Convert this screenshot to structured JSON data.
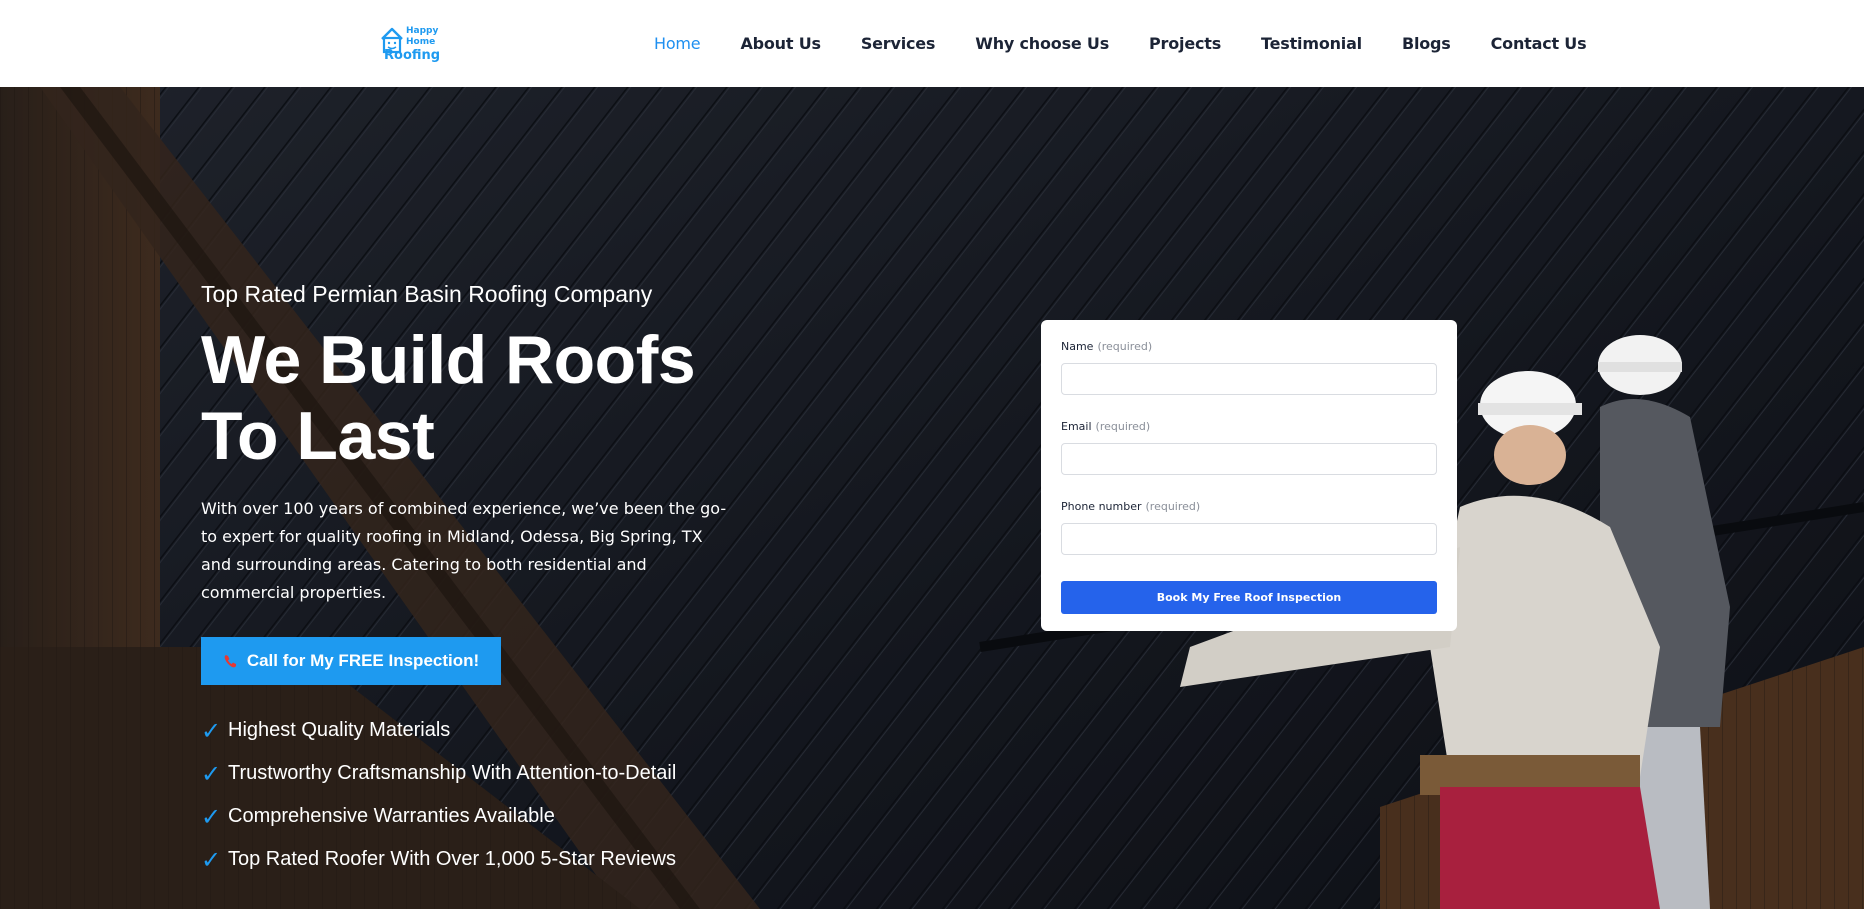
{
  "brand": {
    "logo_line1": "Happy",
    "logo_line2": "Home",
    "logo_line3": "Roofing",
    "accent_color": "#1e9af0"
  },
  "nav": {
    "items": [
      {
        "label": "Home",
        "active": true
      },
      {
        "label": "About Us"
      },
      {
        "label": "Services"
      },
      {
        "label": "Why choose Us"
      },
      {
        "label": "Projects"
      },
      {
        "label": "Testimonial"
      },
      {
        "label": "Blogs"
      },
      {
        "label": "Contact Us"
      }
    ]
  },
  "hero": {
    "eyebrow": "Top Rated Permian Basin Roofing Company",
    "headline_line1": "We Build Roofs",
    "headline_line2": "To Last",
    "description": "With over 100 years of combined experience, we’ve been the go-to expert for quality roofing in Midland, Odessa, Big Spring, TX and surrounding areas. Catering to both residential and commercial properties.",
    "cta_label": "Call for My FREE Inspection!",
    "checklist": [
      "Highest Quality Materials",
      "Trustworthy Craftsmanship With Attention-to-Detail",
      "Comprehensive Warranties Available",
      "Top Rated Roofer With Over 1,000 5-Star Reviews"
    ]
  },
  "form": {
    "name_label": "Name",
    "email_label": "Email",
    "phone_label": "Phone number",
    "required_text": "(required)",
    "name_value": "",
    "email_value": "",
    "phone_value": "",
    "submit_label": "Book My Free Roof Inspection",
    "submit_color": "#2563eb"
  }
}
